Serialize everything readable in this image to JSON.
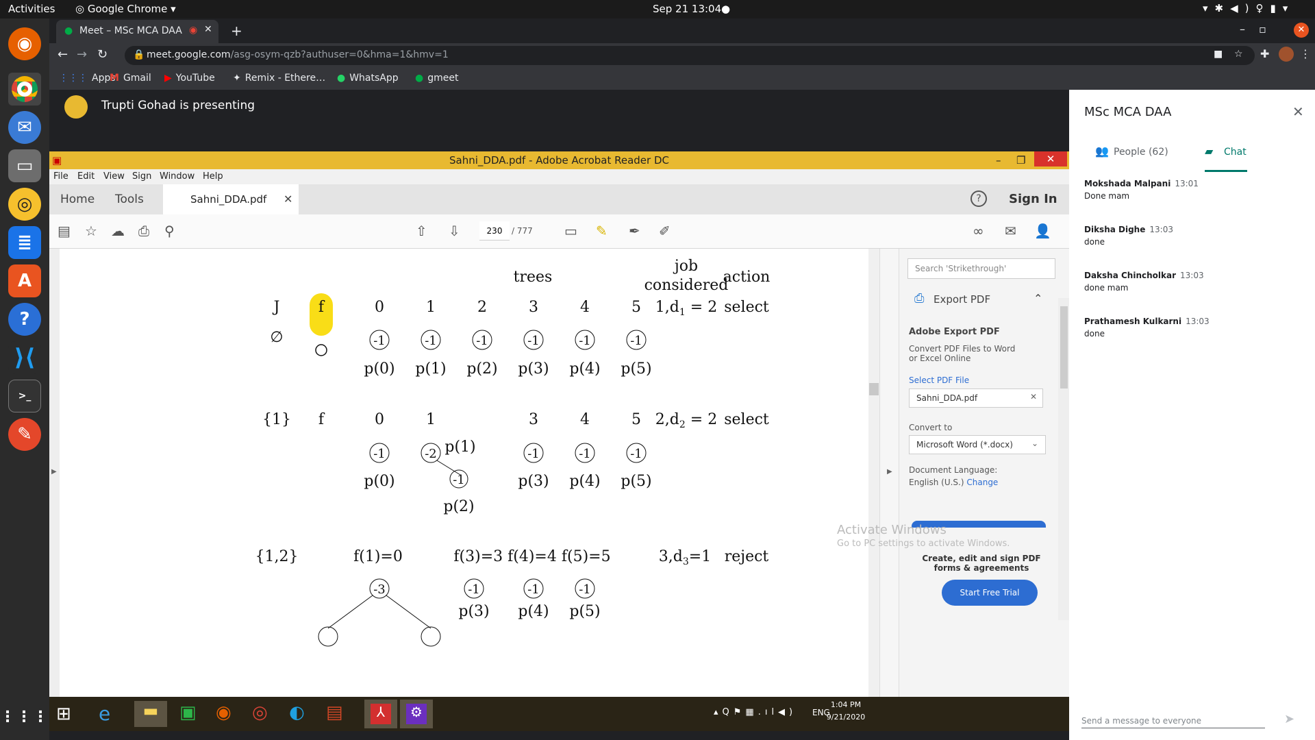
{
  "os": {
    "activities": "Activities",
    "app": "Google Chrome",
    "clock": "Sep 21  13:04"
  },
  "chrome": {
    "tab_title": "Meet – MSc MCA DAA",
    "url_host": "meet.google.com",
    "url_path": "/asg-osym-qzb?authuser=0&hma=1&hmv=1",
    "bookmarks": [
      "Apps",
      "Gmail",
      "YouTube",
      "Remix - Ethere…",
      "WhatsApp",
      "gmeet"
    ]
  },
  "meet": {
    "presenter": "Trupti Gohad is presenting"
  },
  "acrobat": {
    "title": "Sahni_DDA.pdf - Adobe Acrobat Reader DC",
    "menu": [
      "File",
      "Edit",
      "View",
      "Sign",
      "Window",
      "Help"
    ],
    "tabs": {
      "home": "Home",
      "tools": "Tools",
      "doc": "Sahni_DDA.pdf",
      "signin": "Sign In"
    },
    "page_current": "230",
    "page_total": "/ 777",
    "pane": {
      "search_placeholder": "Search 'Strikethrough'",
      "export_pdf": "Export PDF",
      "adobe_export": "Adobe Export PDF",
      "convert_desc": "Convert PDF Files to Word or Excel Online",
      "select_file": "Select PDF File",
      "file_name": "Sahni_DDA.pdf",
      "convert_to": "Convert to",
      "format": "Microsoft Word (*.docx)",
      "doc_lang": "Document Language:",
      "lang_value": "English (U.S.)",
      "change": "Change",
      "promo": "Create, edit and sign PDF forms & agreements",
      "trial": "Start Free Trial"
    },
    "watermark1": "Activate Windows",
    "watermark2": "Go to PC settings to activate Windows."
  },
  "doc": {
    "trees": "trees",
    "job_considered_1": "job",
    "job_considered_2": "considered",
    "action": "action",
    "r1": {
      "J": "J",
      "f": "f",
      "cols": [
        "0",
        "1",
        "2",
        "3",
        "4",
        "5"
      ],
      "job": "1,d",
      "jobsub": "1",
      "jobeq": " = 2",
      "action": "select",
      "nodes": [
        "-1",
        "-1",
        "-1",
        "-1",
        "-1",
        "-1"
      ],
      "labels": [
        "p(0)",
        "p(1)",
        "p(2)",
        "p(3)",
        "p(4)",
        "p(5)"
      ],
      "empty": "∅"
    },
    "r2": {
      "J": "{1}",
      "f": "f",
      "cols": [
        "0",
        "1",
        "3",
        "4",
        "5"
      ],
      "job": "2,d",
      "jobsub": "2",
      "jobeq": " = 2",
      "action": "select",
      "nodes": [
        "-1",
        "-2",
        "-1",
        "-1",
        "-1"
      ],
      "child": "-1",
      "p1": "p(1)",
      "labels": [
        "p(0)",
        "p(3)",
        "p(4)",
        "p(5)"
      ],
      "p2": "p(2)"
    },
    "r3": {
      "J": "{1,2}",
      "f1": "f(1)=0",
      "f345": "f(3)=3 f(4)=4 f(5)=5",
      "job": "3,d",
      "jobsub": "3",
      "jobeq": "=1",
      "action": "reject",
      "root": "-3",
      "nodes": [
        "-1",
        "-1",
        "-1"
      ],
      "labels": [
        "p(3)",
        "p(4)",
        "p(5)"
      ]
    }
  },
  "taskbar": {
    "lang": "ENG",
    "time": "1:04 PM",
    "date": "9/21/2020"
  },
  "side": {
    "title": "MSc MCA DAA",
    "people": "People (62)",
    "chat": "Chat",
    "messages": [
      {
        "name": "Mokshada Malpani",
        "time": "13:01",
        "text": "Done mam"
      },
      {
        "name": "Diksha Dighe",
        "time": "13:03",
        "text": "done"
      },
      {
        "name": "Daksha Chincholkar",
        "time": "13:03",
        "text": "done mam"
      },
      {
        "name": "Prathamesh Kulkarni",
        "time": "13:03",
        "text": "done"
      }
    ],
    "input_placeholder": "Send a message to everyone"
  }
}
